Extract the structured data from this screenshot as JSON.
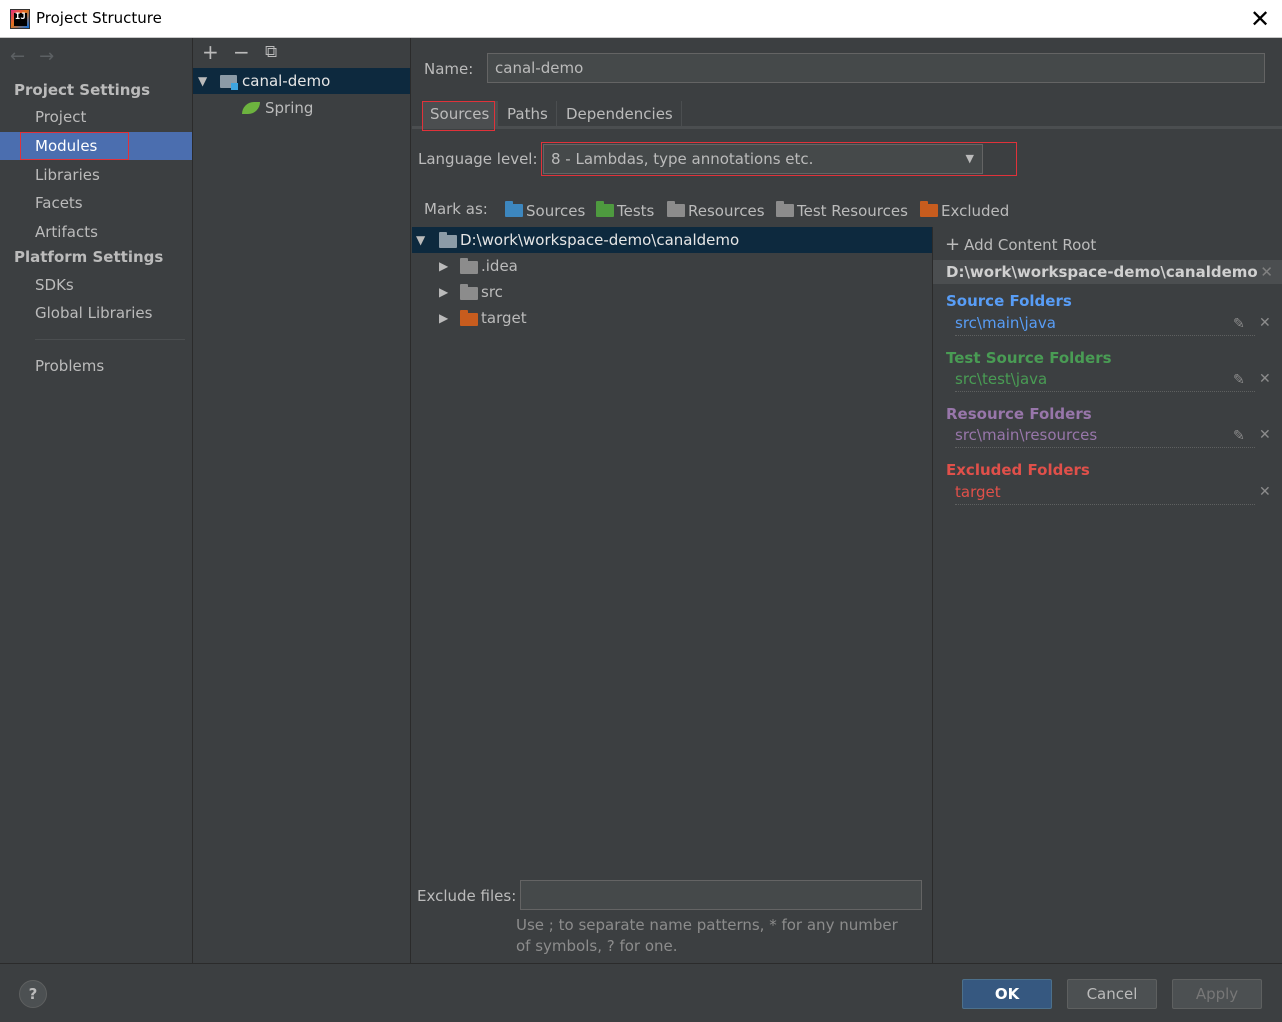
{
  "window": {
    "title": "Project Structure",
    "icon_text": "IJ"
  },
  "sidebar": {
    "back_icon": "←",
    "forward_icon": "→",
    "project_settings_header": "Project Settings",
    "project_items": [
      "Project",
      "Modules",
      "Libraries",
      "Facets",
      "Artifacts"
    ],
    "platform_settings_header": "Platform Settings",
    "platform_items": [
      "SDKs",
      "Global Libraries"
    ],
    "problems": "Problems",
    "selected": "Modules"
  },
  "modules": {
    "toolbar": {
      "add": "+",
      "remove": "−",
      "copy": "⧉"
    },
    "tree": [
      {
        "label": "canal-demo",
        "kind": "module",
        "selected": true
      },
      {
        "label": "Spring",
        "kind": "facet"
      }
    ]
  },
  "main": {
    "name_label": "Name:",
    "name_value": "canal-demo",
    "tabs": [
      "Sources",
      "Paths",
      "Dependencies"
    ],
    "active_tab": "Sources",
    "language_level_label": "Language level:",
    "language_level_value": "8 - Lambdas, type annotations etc.",
    "mark_as_label": "Mark as:",
    "mark_as": [
      {
        "label": "Sources",
        "color": "#3d87bf"
      },
      {
        "label": "Tests",
        "color": "#4e9a3f"
      },
      {
        "label": "Resources",
        "color": "#8c8c8c"
      },
      {
        "label": "Test Resources",
        "color": "#8c8c8c"
      },
      {
        "label": "Excluded",
        "color": "#c75c1e"
      }
    ],
    "content_tree": [
      {
        "label": "D:\\work\\workspace-demo\\canaldemo",
        "expanded": true,
        "selected": true
      },
      {
        "label": ".idea"
      },
      {
        "label": "src"
      },
      {
        "label": "target",
        "excluded": true
      }
    ],
    "exclude_files_label": "Exclude files:",
    "exclude_files_value": "",
    "exclude_hint": "Use ; to separate name patterns, * for any number of symbols, ? for one."
  },
  "roots": {
    "add_content_root": "Add Content Root",
    "root_path": "D:\\work\\workspace-demo\\canaldemo",
    "groups": [
      {
        "title": "Source Folders",
        "path": "src\\main\\java",
        "title_color": "#589df6",
        "path_color": "#589df6"
      },
      {
        "title": "Test Source Folders",
        "path": "src\\test\\java",
        "title_color": "#499c54",
        "path_color": "#499c54"
      },
      {
        "title": "Resource Folders",
        "path": "src\\main\\resources",
        "title_color": "#9876aa",
        "path_color": "#9876aa"
      },
      {
        "title": "Excluded Folders",
        "path": "target",
        "title_color": "#e0504a",
        "path_color": "#e0504a"
      }
    ]
  },
  "buttons": {
    "help": "?",
    "ok": "OK",
    "cancel": "Cancel",
    "apply": "Apply"
  },
  "colors": {
    "accent": "#4b6eaf",
    "highlight": "#e0323a",
    "tree_selection": "#0d293e",
    "ok_button": "#365880"
  }
}
